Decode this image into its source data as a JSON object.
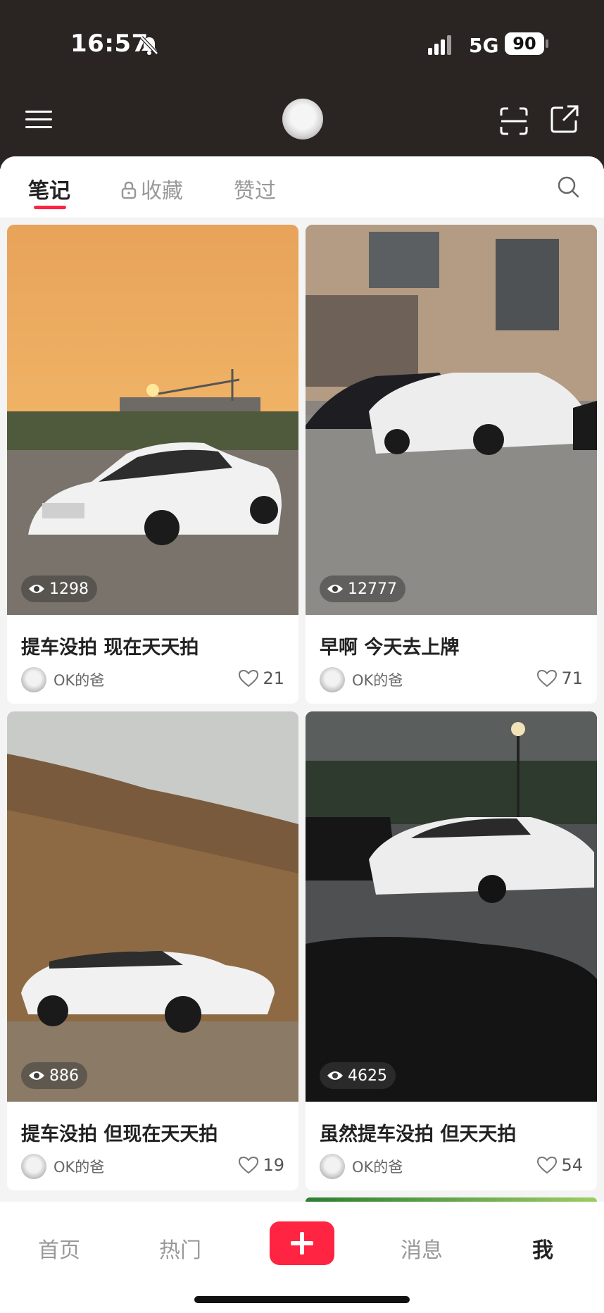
{
  "status_bar": {
    "time": "16:57",
    "network": "5G",
    "battery": "90"
  },
  "tabs": [
    {
      "label": "笔记",
      "active": true
    },
    {
      "label": "收藏",
      "active": false,
      "icon": "lock-icon"
    },
    {
      "label": "赞过",
      "active": false
    }
  ],
  "cards": [
    {
      "title": "提车没拍 现在天天拍",
      "views": "1298",
      "author": "OK的爸",
      "likes": "21"
    },
    {
      "title": "早啊 今天去上牌",
      "views": "12777",
      "author": "OK的爸",
      "likes": "71"
    },
    {
      "title": "提车没拍 但现在天天拍",
      "views": "886",
      "author": "OK的爸",
      "likes": "19"
    },
    {
      "title": "虽然提车没拍 但天天拍",
      "views": "4625",
      "author": "OK的爸",
      "likes": "54"
    }
  ],
  "bottom_nav": {
    "home": "首页",
    "hot": "热门",
    "messages": "消息",
    "me": "我"
  },
  "colors": {
    "accent": "#ff2442",
    "header_bg": "#2a2523"
  }
}
